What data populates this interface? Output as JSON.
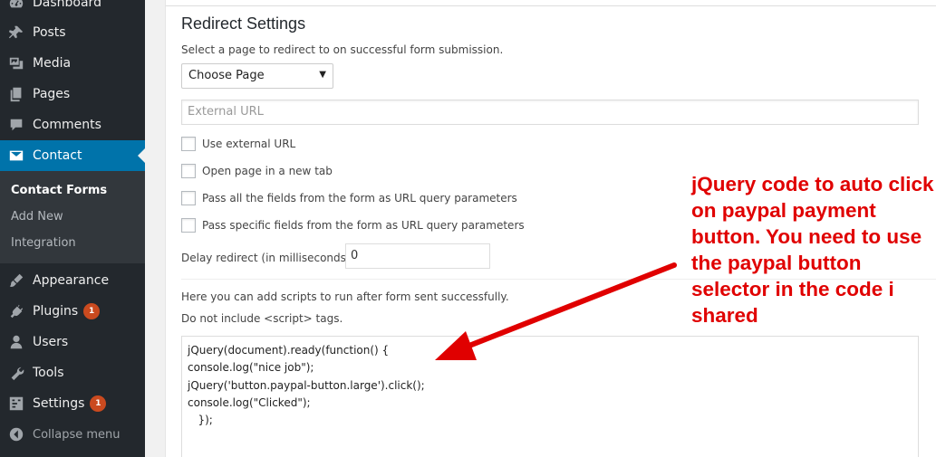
{
  "sidebar": {
    "items": [
      {
        "label": "Dashboard",
        "icon": "dashboard-icon",
        "badge": null
      },
      {
        "label": "Posts",
        "icon": "pin-icon",
        "badge": null
      },
      {
        "label": "Media",
        "icon": "media-icon",
        "badge": null
      },
      {
        "label": "Pages",
        "icon": "pages-icon",
        "badge": null
      },
      {
        "label": "Comments",
        "icon": "comment-icon",
        "badge": null
      },
      {
        "label": "Contact",
        "icon": "envelope-icon",
        "badge": null
      },
      {
        "label": "Appearance",
        "icon": "brush-icon",
        "badge": null
      },
      {
        "label": "Plugins",
        "icon": "plug-icon",
        "badge": "1"
      },
      {
        "label": "Users",
        "icon": "user-icon",
        "badge": null
      },
      {
        "label": "Tools",
        "icon": "wrench-icon",
        "badge": null
      },
      {
        "label": "Settings",
        "icon": "settings-icon",
        "badge": "1"
      }
    ],
    "submenu": [
      "Contact Forms",
      "Add New",
      "Integration"
    ],
    "collapse_label": "Collapse menu"
  },
  "redirect": {
    "heading": "Redirect Settings",
    "select_desc": "Select a page to redirect to on successful form submission.",
    "select_value": "Choose Page",
    "external_url_placeholder": "External URL",
    "checkboxes": [
      "Use external URL",
      "Open page in a new tab",
      "Pass all the fields from the form as URL query parameters",
      "Pass specific fields from the form as URL query parameters"
    ],
    "delay_label": "Delay redirect (in milliseconds)",
    "delay_value": "0",
    "scripts_desc1": "Here you can add scripts to run after form sent successfully.",
    "scripts_desc2": "Do not include <script> tags.",
    "code": "jQuery(document).ready(function() {\nconsole.log(\"nice job\");\njQuery('button.paypal-button.large').click();\nconsole.log(\"Clicked\");\n   });"
  },
  "annotation": {
    "text": "jQuery code to auto click on paypal payment button. You need to use the paypal button selector  in the code i shared",
    "color": "#e00000"
  },
  "colors": {
    "sidebar_bg": "#23282d",
    "accent": "#0073aa",
    "badge": "#ca4a1f"
  }
}
